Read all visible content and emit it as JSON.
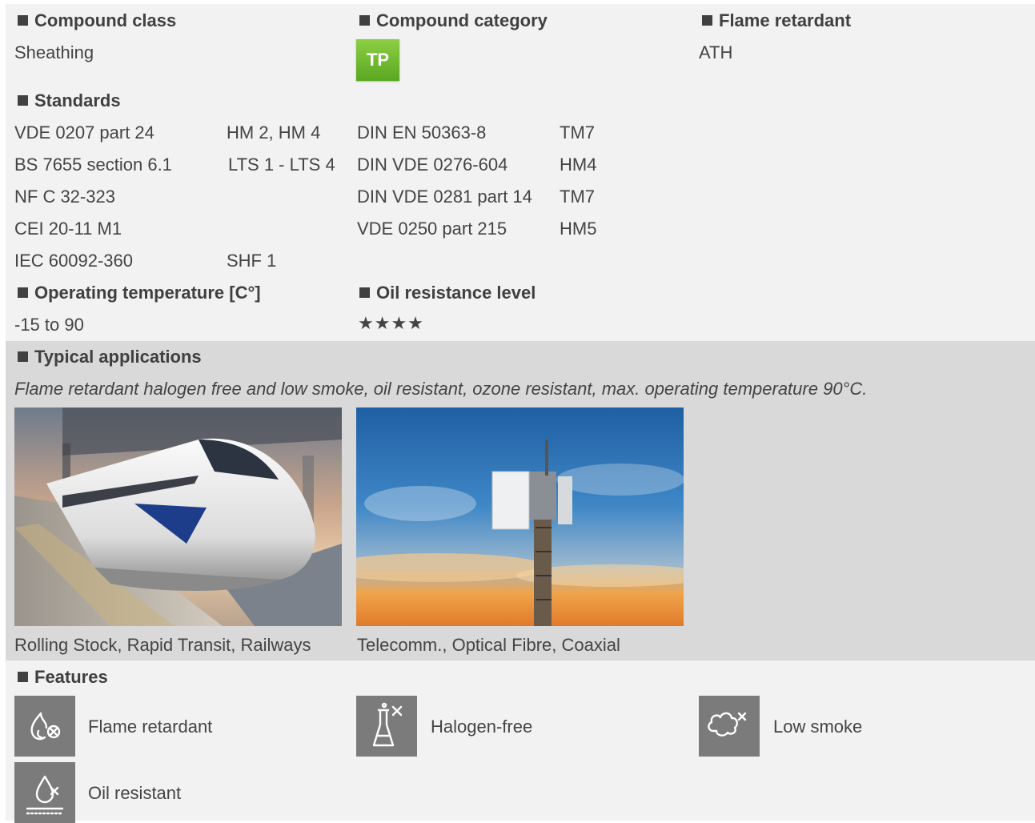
{
  "compound_class": {
    "heading": "Compound class",
    "value": "Sheathing"
  },
  "compound_category": {
    "heading": "Compound category",
    "badge": "TP",
    "badge_color": "#6bbb2c"
  },
  "flame_retardant": {
    "heading": "Flame retardant",
    "value": "ATH"
  },
  "standards": {
    "heading": "Standards",
    "left": [
      {
        "name": "VDE 0207 part 24",
        "grade": "HM 2, HM 4"
      },
      {
        "name": "BS 7655 section 6.1",
        "grade": "LTS 1 - LTS 4"
      },
      {
        "name": "NF C 32-323",
        "grade": ""
      },
      {
        "name": "CEI 20-11 M1",
        "grade": ""
      },
      {
        "name": "IEC 60092-360",
        "grade": "SHF 1"
      }
    ],
    "right": [
      {
        "name": "DIN EN 50363-8",
        "grade": "TM7"
      },
      {
        "name": "DIN VDE 0276-604",
        "grade": "HM4"
      },
      {
        "name": "DIN VDE 0281 part 14",
        "grade": "TM7"
      },
      {
        "name": "VDE 0250 part 215",
        "grade": "HM5"
      }
    ]
  },
  "operating_temperature": {
    "heading": "Operating temperature [C°]",
    "value": "-15 to 90"
  },
  "oil_resistance": {
    "heading": "Oil resistance level",
    "stars": "★★★★",
    "rating": 4
  },
  "typical_applications": {
    "heading": "Typical applications",
    "description": "Flame retardant halogen free and low smoke, oil resistant, ozone resistant, max. operating temperature 90°C.",
    "items": [
      {
        "caption": "Rolling Stock, Rapid Transit, Railways",
        "image": "high-speed-train-photo"
      },
      {
        "caption": "Telecomm., Optical Fibre, Coaxial",
        "image": "telecom-tower-photo"
      }
    ]
  },
  "features": {
    "heading": "Features",
    "items": [
      {
        "label": "Flame retardant",
        "icon": "flame-retardant-icon"
      },
      {
        "label": "Halogen-free",
        "icon": "halogen-free-icon"
      },
      {
        "label": "Low smoke",
        "icon": "low-smoke-icon"
      },
      {
        "label": "Oil resistant",
        "icon": "oil-resistant-icon"
      }
    ]
  },
  "colors": {
    "light_band": "#f2f2f2",
    "dark_band": "#d9d9d9",
    "icon_bg": "#7b7b7b",
    "text": "#444444"
  }
}
